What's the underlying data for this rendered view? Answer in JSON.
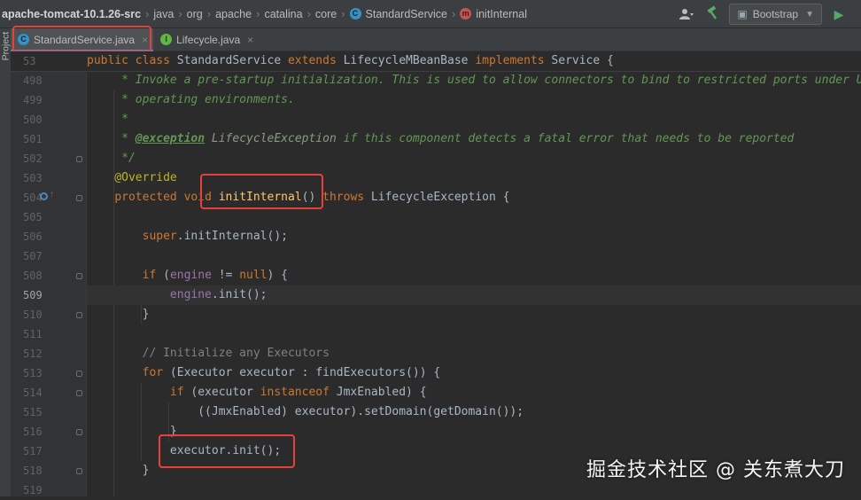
{
  "breadcrumb": {
    "project": "apache-tomcat-10.1.26-src",
    "parts": [
      "java",
      "org",
      "apache",
      "catalina",
      "core"
    ],
    "class_icon": "C",
    "class_name": "StandardService",
    "method_icon": "m",
    "method_name": "initInternal"
  },
  "toolbar": {
    "user_icon": "user-icon",
    "build_icon": "hammer-icon",
    "run_config": "Bootstrap",
    "run_icon": "run-icon"
  },
  "side": {
    "project_label": "Project"
  },
  "tabs": [
    {
      "icon": "C",
      "label": "StandardService.java",
      "close": "×",
      "active": true
    },
    {
      "icon": "I",
      "label": "Lifecycle.java",
      "close": "×",
      "active": false
    }
  ],
  "sticky": {
    "line_number": "53",
    "code": "public class StandardService extends LifecycleMBeanBase implements Service {"
  },
  "lines": [
    {
      "n": "498",
      "text": "     * Invoke a pre-startup initialization. This is used to allow connectors to bind to restricted ports under U"
    },
    {
      "n": "499",
      "text": "     * operating environments."
    },
    {
      "n": "500",
      "text": "     *"
    },
    {
      "n": "501",
      "text": "     * @exception LifecycleException if this component detects a fatal error that needs to be reported"
    },
    {
      "n": "502",
      "text": "     */"
    },
    {
      "n": "503",
      "text": "    @Override"
    },
    {
      "n": "504",
      "text": "    protected void initInternal() throws LifecycleException {"
    },
    {
      "n": "505",
      "text": ""
    },
    {
      "n": "506",
      "text": "        super.initInternal();"
    },
    {
      "n": "507",
      "text": ""
    },
    {
      "n": "508",
      "text": "        if (engine != null) {"
    },
    {
      "n": "509",
      "text": "            engine.init();"
    },
    {
      "n": "510",
      "text": "        }"
    },
    {
      "n": "511",
      "text": ""
    },
    {
      "n": "512",
      "text": "        // Initialize any Executors"
    },
    {
      "n": "513",
      "text": "        for (Executor executor : findExecutors()) {"
    },
    {
      "n": "514",
      "text": "            if (executor instanceof JmxEnabled) {"
    },
    {
      "n": "515",
      "text": "                ((JmxEnabled) executor).setDomain(getDomain());"
    },
    {
      "n": "516",
      "text": "            }"
    },
    {
      "n": "517",
      "text": "            executor.init();"
    },
    {
      "n": "518",
      "text": "        }"
    },
    {
      "n": "519",
      "text": ""
    }
  ],
  "current_line": "509",
  "watermark": "掘金技术社区 @ 关东煮大刀",
  "colors": {
    "keyword": "#cc7832",
    "comment": "#629755",
    "annotation": "#bbb529",
    "method": "#ffc66d",
    "field": "#9876aa",
    "highlight_box": "#e8413b"
  }
}
